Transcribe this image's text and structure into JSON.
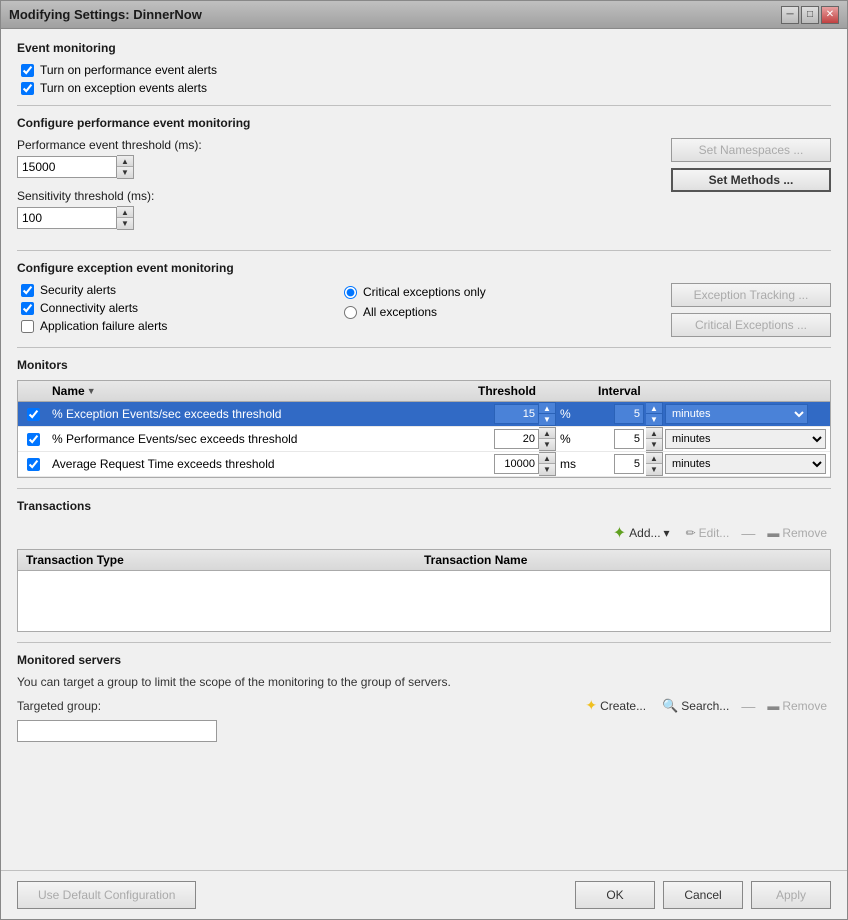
{
  "window": {
    "title": "Modifying Settings: DinnerNow"
  },
  "event_monitoring": {
    "section_title": "Event monitoring",
    "checkbox1_label": "Turn on performance event alerts",
    "checkbox1_checked": true,
    "checkbox2_label": "Turn on exception events alerts",
    "checkbox2_checked": true
  },
  "configure_performance": {
    "section_title": "Configure performance event monitoring",
    "threshold_label": "Performance event threshold (ms):",
    "threshold_value": "15000",
    "sensitivity_label": "Sensitivity threshold (ms):",
    "sensitivity_value": "100",
    "set_namespaces_btn": "Set Namespaces ...",
    "set_methods_btn": "Set Methods ..."
  },
  "configure_exception": {
    "section_title": "Configure exception event monitoring",
    "security_alerts_label": "Security alerts",
    "security_checked": true,
    "connectivity_alerts_label": "Connectivity alerts",
    "connectivity_checked": true,
    "app_failure_label": "Application failure alerts",
    "app_failure_checked": false,
    "critical_only_label": "Critical exceptions only",
    "all_exceptions_label": "All exceptions",
    "exception_tracking_btn": "Exception Tracking ...",
    "critical_exceptions_btn": "Critical Exceptions ..."
  },
  "monitors": {
    "section_title": "Monitors",
    "col_name": "Name",
    "col_threshold": "Threshold",
    "col_interval": "Interval",
    "rows": [
      {
        "checked": true,
        "name": "% Exception Events/sec exceeds threshold",
        "threshold_value": "15",
        "threshold_unit": "%",
        "interval_value": "5",
        "interval_unit": "minutes",
        "selected": true
      },
      {
        "checked": true,
        "name": "% Performance Events/sec exceeds threshold",
        "threshold_value": "20",
        "threshold_unit": "%",
        "interval_value": "5",
        "interval_unit": "minutes",
        "selected": false
      },
      {
        "checked": true,
        "name": "Average Request Time exceeds threshold",
        "threshold_value": "10000",
        "threshold_unit": "ms",
        "interval_value": "5",
        "interval_unit": "minutes",
        "selected": false
      }
    ]
  },
  "transactions": {
    "section_title": "Transactions",
    "add_btn": "Add...",
    "edit_btn": "Edit...",
    "remove_btn": "Remove",
    "col_type": "Transaction Type",
    "col_name": "Transaction Name"
  },
  "monitored_servers": {
    "section_title": "Monitored servers",
    "description": "You can target a group to limit the scope of the monitoring to the group of servers.",
    "targeted_label": "Targeted group:",
    "create_btn": "Create...",
    "search_btn": "Search...",
    "remove_btn": "Remove"
  },
  "bottom": {
    "default_config_btn": "Use Default Configuration",
    "ok_btn": "OK",
    "cancel_btn": "Cancel",
    "apply_btn": "Apply"
  }
}
